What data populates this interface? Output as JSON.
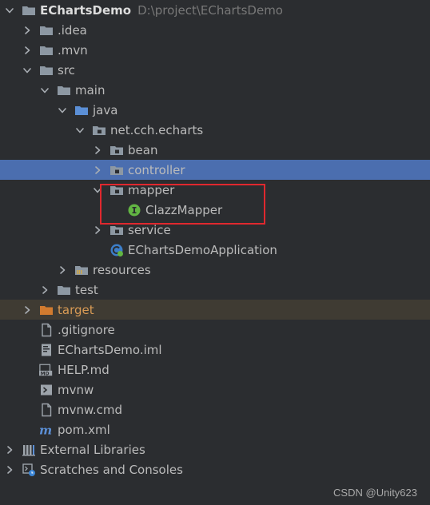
{
  "project": {
    "name": "EChartsDemo",
    "path": "D:\\project\\EChartsDemo"
  },
  "rows": [
    {
      "label": "EChartsDemo",
      "hint": "D:\\project\\EChartsDemo",
      "icon": "folder-icon",
      "expand": "expanded",
      "level": 0,
      "bold": true,
      "name": "tree-node-echartsdemo"
    },
    {
      "label": ".idea",
      "icon": "folder-icon",
      "expand": "collapsed",
      "level": 1,
      "name": "tree-node-idea"
    },
    {
      "label": ".mvn",
      "icon": "folder-icon",
      "expand": "collapsed",
      "level": 1,
      "name": "tree-node-mvn"
    },
    {
      "label": "src",
      "icon": "folder-icon",
      "expand": "expanded",
      "level": 1,
      "name": "tree-node-src"
    },
    {
      "label": "main",
      "icon": "folder-icon",
      "expand": "expanded",
      "level": 2,
      "name": "tree-node-main"
    },
    {
      "label": "java",
      "icon": "source-folder-icon",
      "expand": "expanded",
      "level": 3,
      "name": "tree-node-java"
    },
    {
      "label": "net.cch.echarts",
      "icon": "package-icon",
      "expand": "expanded",
      "level": 4,
      "name": "tree-node-net-cch-echarts"
    },
    {
      "label": "bean",
      "icon": "package-icon",
      "expand": "collapsed",
      "level": 5,
      "name": "tree-node-bean"
    },
    {
      "label": "controller",
      "icon": "package-icon",
      "expand": "collapsed",
      "level": 5,
      "selected": true,
      "name": "tree-node-controller"
    },
    {
      "label": "mapper",
      "icon": "package-icon",
      "expand": "expanded",
      "level": 5,
      "name": "tree-node-mapper"
    },
    {
      "label": "ClazzMapper",
      "icon": "interface-icon",
      "expand": "none",
      "level": 6,
      "name": "tree-node-clazzmapper"
    },
    {
      "label": "service",
      "icon": "package-icon",
      "expand": "collapsed",
      "level": 5,
      "name": "tree-node-service"
    },
    {
      "label": "EChartsDemoApplication",
      "icon": "spring-class-icon",
      "expand": "none",
      "level": 5,
      "name": "tree-node-echartsdemoapplication"
    },
    {
      "label": "resources",
      "icon": "resources-folder-icon",
      "expand": "collapsed",
      "level": 3,
      "name": "tree-node-resources"
    },
    {
      "label": "test",
      "icon": "folder-icon",
      "expand": "collapsed",
      "level": 2,
      "name": "tree-node-test"
    },
    {
      "label": "target",
      "icon": "excluded-folder-icon",
      "expand": "collapsed",
      "level": 1,
      "excluded": true,
      "name": "tree-node-target"
    },
    {
      "label": ".gitignore",
      "icon": "file-icon",
      "expand": "none",
      "level": 1,
      "name": "tree-node-gitignore"
    },
    {
      "label": "EChartsDemo.iml",
      "icon": "iml-file-icon",
      "expand": "none",
      "level": 1,
      "name": "tree-node-echartsdemo-iml"
    },
    {
      "label": "HELP.md",
      "icon": "markdown-file-icon",
      "expand": "none",
      "level": 1,
      "name": "tree-node-help-md"
    },
    {
      "label": "mvnw",
      "icon": "terminal-file-icon",
      "expand": "none",
      "level": 1,
      "name": "tree-node-mvnw"
    },
    {
      "label": "mvnw.cmd",
      "icon": "file-icon",
      "expand": "none",
      "level": 1,
      "name": "tree-node-mvnw-cmd"
    },
    {
      "label": "pom.xml",
      "icon": "maven-icon",
      "expand": "none",
      "level": 1,
      "name": "tree-node-pom-xml"
    },
    {
      "label": "External Libraries",
      "icon": "libraries-icon",
      "expand": "collapsed",
      "level": 0,
      "name": "tree-node-external-libraries"
    },
    {
      "label": "Scratches and Consoles",
      "icon": "scratches-icon",
      "expand": "collapsed",
      "level": 0,
      "name": "tree-node-scratches-and-consoles"
    }
  ],
  "colors": {
    "background": "#2b2d30",
    "selected_row": "#4b6eaf",
    "excluded_row": "#3f3b33",
    "folder": "#8d98a3",
    "source_folder": "#5b8fd6",
    "excluded_folder": "#d17b2f",
    "interface": "#62b543",
    "highlight_box": "#e0282e"
  },
  "watermark": "CSDN @Unity623"
}
